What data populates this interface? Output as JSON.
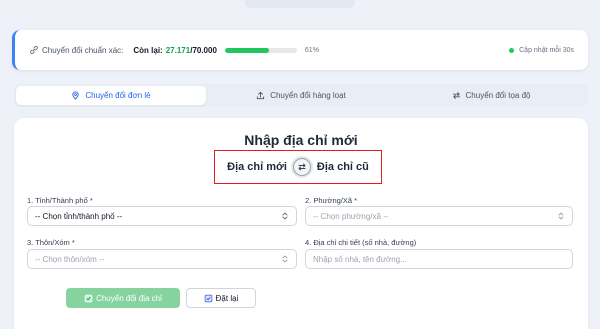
{
  "quota": {
    "title": "Chuyển đổi chuẩn xác:",
    "remaining_label": "Còn lại:",
    "used": "27.171",
    "total": "70.000",
    "progress_percent": 61,
    "progress_label": "61%",
    "update_text": "Cập nhật mỗi 30s"
  },
  "tabs": [
    {
      "label": "Chuyển đổi đơn lẻ",
      "icon": "map-pin-icon",
      "active": true
    },
    {
      "label": "Chuyển đổi hàng loạt",
      "icon": "upload-icon",
      "active": false
    },
    {
      "label": "Chuyển đổi tọa độ",
      "icon": "swap-arrows-icon",
      "active": false
    }
  ],
  "form": {
    "title": "Nhập địa chỉ mới",
    "toggle_left": "Địa chỉ mới",
    "toggle_right": "Địa chỉ cũ",
    "province_label": "1. Tỉnh/Thành phố *",
    "province_value": "-- Chọn tỉnh/thành phố --",
    "ward_label": "2. Phường/Xã *",
    "ward_placeholder": "-- Chọn phường/xã --",
    "hamlet_label": "3. Thôn/Xóm *",
    "hamlet_placeholder": "-- Chọn thôn/xóm --",
    "detail_label": "4. Địa chỉ chi tiết (số nhà, đường)",
    "detail_placeholder": "Nhập số nhà, tên đường...",
    "submit_label": "Chuyển đổi địa chỉ",
    "reset_label": "Đặt lại"
  },
  "colors": {
    "accent": "#3b82f6",
    "success": "#22c55e",
    "highlight_border": "#e11d1d"
  }
}
